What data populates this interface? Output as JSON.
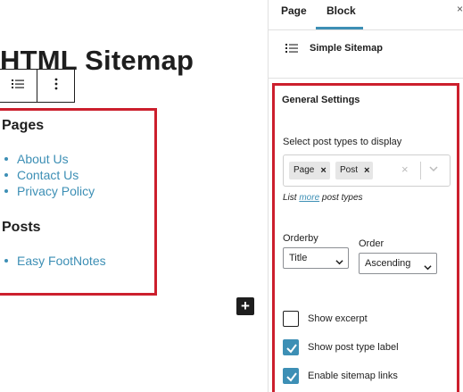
{
  "editor": {
    "post_title": "HTML Sitemap",
    "sitemap": {
      "sections": [
        {
          "heading": "Pages",
          "links": [
            "About Us",
            "Contact Us",
            "Privacy Policy"
          ]
        },
        {
          "heading": "Posts",
          "links": [
            "Easy FootNotes"
          ]
        }
      ]
    },
    "inserter_symbol": "+"
  },
  "sidebar": {
    "tabs": [
      {
        "label": "Page"
      },
      {
        "label": "Block"
      }
    ],
    "active_tab": "Block",
    "close_symbol": "×",
    "block_card": {
      "title": "Simple Sitemap",
      "icon": "list-icon"
    },
    "panel": {
      "title": "General Settings",
      "chevron": "‹",
      "post_types": {
        "label": "Select post types to display",
        "chips": [
          {
            "label": "Page"
          },
          {
            "label": "Post"
          }
        ],
        "chip_remove": "×",
        "clear": "×",
        "helper_prefix": "List ",
        "helper_link": "more",
        "helper_suffix": " post types"
      },
      "orderby": {
        "label": "Orderby",
        "value": "Title"
      },
      "order": {
        "label": "Order",
        "value": "Ascending"
      },
      "checkboxes": [
        {
          "label": "Show excerpt",
          "checked": false
        },
        {
          "label": "Show post type label",
          "checked": true
        },
        {
          "label": "Enable sitemap links",
          "checked": true
        }
      ]
    }
  },
  "colors": {
    "accent": "#3d8fb5",
    "highlight_border": "#cc1f2d",
    "text": "#1e1e1e"
  }
}
